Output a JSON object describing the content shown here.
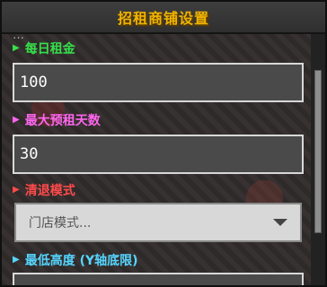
{
  "window": {
    "title": "招租商铺设置"
  },
  "sections": {
    "peek": "…",
    "daily_rent": {
      "label": "每日租金",
      "value": "100",
      "color": "#35e04a"
    },
    "max_prepay_days": {
      "label": "最大预租天数",
      "value": "30",
      "color": "#ff66ee"
    },
    "clear_mode": {
      "label": "清退模式",
      "selected": "门店模式...",
      "color": "#ff4a4a"
    },
    "min_height": {
      "label": "最低高度 (Y轴底限)",
      "color": "#55d6ff"
    }
  },
  "icons": {
    "section_marker": "triangle-right-icon",
    "dropdown": "caret-down-icon"
  },
  "colors": {
    "title": "#f0b400"
  }
}
